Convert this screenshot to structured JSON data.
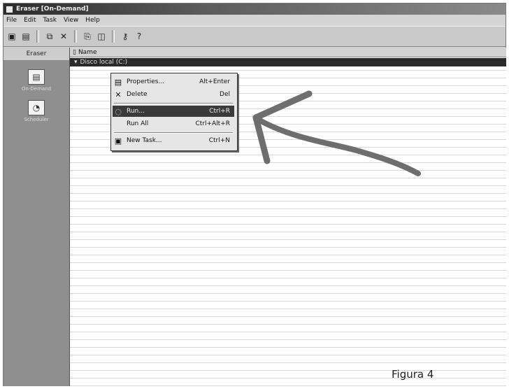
{
  "window": {
    "title": "Eraser [On-Demand]"
  },
  "menu": {
    "items": [
      "File",
      "Edit",
      "Task",
      "View",
      "Help"
    ]
  },
  "toolbar": {
    "icons": [
      "new-icon",
      "properties-icon",
      "open-icon",
      "delete-icon",
      "run-icon",
      "stop-icon",
      "key-icon",
      "help-icon"
    ]
  },
  "sidebar": {
    "header": "Eraser",
    "items": [
      {
        "label": "On-Demand"
      },
      {
        "label": "Scheduler"
      }
    ]
  },
  "list": {
    "column_name": "Name",
    "selected_row": "Disco local (C:)"
  },
  "context_menu": {
    "items": [
      {
        "label": "Properties...",
        "shortcut": "Alt+Enter"
      },
      {
        "label": "Delete",
        "shortcut": "Del"
      },
      {
        "label": "Run...",
        "shortcut": "Ctrl+R"
      },
      {
        "label": "Run All",
        "shortcut": "Ctrl+Alt+R"
      },
      {
        "label": "New Task...",
        "shortcut": "Ctrl+N"
      }
    ]
  },
  "caption": "Figura 4",
  "colors": {
    "titlebar": "#2b2b2b",
    "sidebar": "#8f8f8f",
    "selection": "#2a2a2a",
    "arrow": "#6e6e6e"
  }
}
